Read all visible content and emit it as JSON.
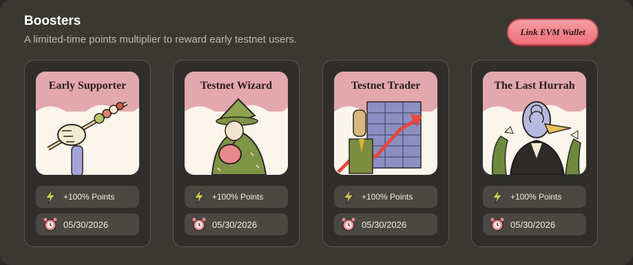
{
  "header": {
    "title": "Boosters",
    "subtitle": "A limited-time points multiplier to reward early testnet users.",
    "link_button": "Link EVM Wallet"
  },
  "boosters": [
    {
      "name": "Early Supporter",
      "points": "+100% Points",
      "expires": "05/30/2026"
    },
    {
      "name": "Testnet Wizard",
      "points": "+100% Points",
      "expires": "05/30/2026"
    },
    {
      "name": "Testnet Trader",
      "points": "+100% Points",
      "expires": "05/30/2026"
    },
    {
      "name": "The Last Hurrah",
      "points": "+100% Points",
      "expires": "05/30/2026"
    }
  ],
  "icons": {
    "points": "lightning-icon",
    "expires": "alarm-clock-icon"
  },
  "colors": {
    "accent": "#ee6f78",
    "lightning": "#c7c55a",
    "clock": "#f08a8c"
  }
}
